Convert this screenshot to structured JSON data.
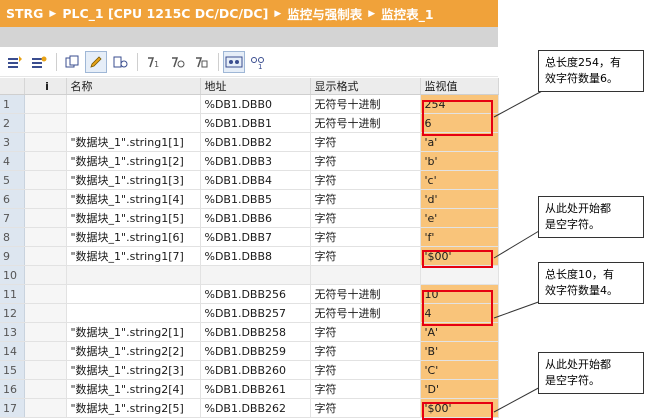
{
  "title": {
    "crumbs": [
      "STRG",
      "PLC_1 [CPU 1215C DC/DC/DC]",
      "监控与强制表",
      "监控表_1"
    ]
  },
  "toolbar": {
    "icons": [
      "insert-row-icon",
      "add-row-icon",
      "copy-icon",
      "edit-icon",
      "monitor-cycle-icon",
      "force-once-icon",
      "force-all-icon",
      "force-settings-icon",
      "monitor-all-icon",
      "monitor-once-icon"
    ]
  },
  "table": {
    "headers": {
      "num": "",
      "icon": "i",
      "name": "名称",
      "address": "地址",
      "format": "显示格式",
      "value": "监视值"
    },
    "rows": [
      {
        "num": "1",
        "name": "",
        "address": "%DB1.DBB0",
        "format": "无符号十进制",
        "value": "254"
      },
      {
        "num": "2",
        "name": "",
        "address": "%DB1.DBB1",
        "format": "无符号十进制",
        "value": "6"
      },
      {
        "num": "3",
        "name": "\"数据块_1\".string1[1]",
        "address": "%DB1.DBB2",
        "format": "字符",
        "value": "'a'"
      },
      {
        "num": "4",
        "name": "\"数据块_1\".string1[2]",
        "address": "%DB1.DBB3",
        "format": "字符",
        "value": "'b'"
      },
      {
        "num": "5",
        "name": "\"数据块_1\".string1[3]",
        "address": "%DB1.DBB4",
        "format": "字符",
        "value": "'c'"
      },
      {
        "num": "6",
        "name": "\"数据块_1\".string1[4]",
        "address": "%DB1.DBB5",
        "format": "字符",
        "value": "'d'"
      },
      {
        "num": "7",
        "name": "\"数据块_1\".string1[5]",
        "address": "%DB1.DBB6",
        "format": "字符",
        "value": "'e'"
      },
      {
        "num": "8",
        "name": "\"数据块_1\".string1[6]",
        "address": "%DB1.DBB7",
        "format": "字符",
        "value": "'f'"
      },
      {
        "num": "9",
        "name": "\"数据块_1\".string1[7]",
        "address": "%DB1.DBB8",
        "format": "字符",
        "value": "'$00'"
      },
      {
        "num": "10",
        "name": "",
        "address": "",
        "format": "",
        "value": ""
      },
      {
        "num": "11",
        "name": "",
        "address": "%DB1.DBB256",
        "format": "无符号十进制",
        "value": "10"
      },
      {
        "num": "12",
        "name": "",
        "address": "%DB1.DBB257",
        "format": "无符号十进制",
        "value": "4"
      },
      {
        "num": "13",
        "name": "\"数据块_1\".string2[1]",
        "address": "%DB1.DBB258",
        "format": "字符",
        "value": "'A'"
      },
      {
        "num": "14",
        "name": "\"数据块_1\".string2[2]",
        "address": "%DB1.DBB259",
        "format": "字符",
        "value": "'B'"
      },
      {
        "num": "15",
        "name": "\"数据块_1\".string2[3]",
        "address": "%DB1.DBB260",
        "format": "字符",
        "value": "'C'"
      },
      {
        "num": "16",
        "name": "\"数据块_1\".string2[4]",
        "address": "%DB1.DBB261",
        "format": "字符",
        "value": "'D'"
      },
      {
        "num": "17",
        "name": "\"数据块_1\".string2[5]",
        "address": "%DB1.DBB262",
        "format": "字符",
        "value": "'$00'"
      }
    ]
  },
  "annotations": {
    "a1": [
      "总长度254，有",
      "效字符数量6。"
    ],
    "a2": [
      "从此处开始都",
      "是空字符。"
    ],
    "a3": [
      "总长度10，有",
      "效字符数量4。"
    ],
    "a4": [
      "从此处开始都",
      "是空字符。"
    ]
  },
  "colors": {
    "title_bar": "#f0a23a",
    "value_cell": "#f9c47a",
    "highlight": "#e60012"
  }
}
